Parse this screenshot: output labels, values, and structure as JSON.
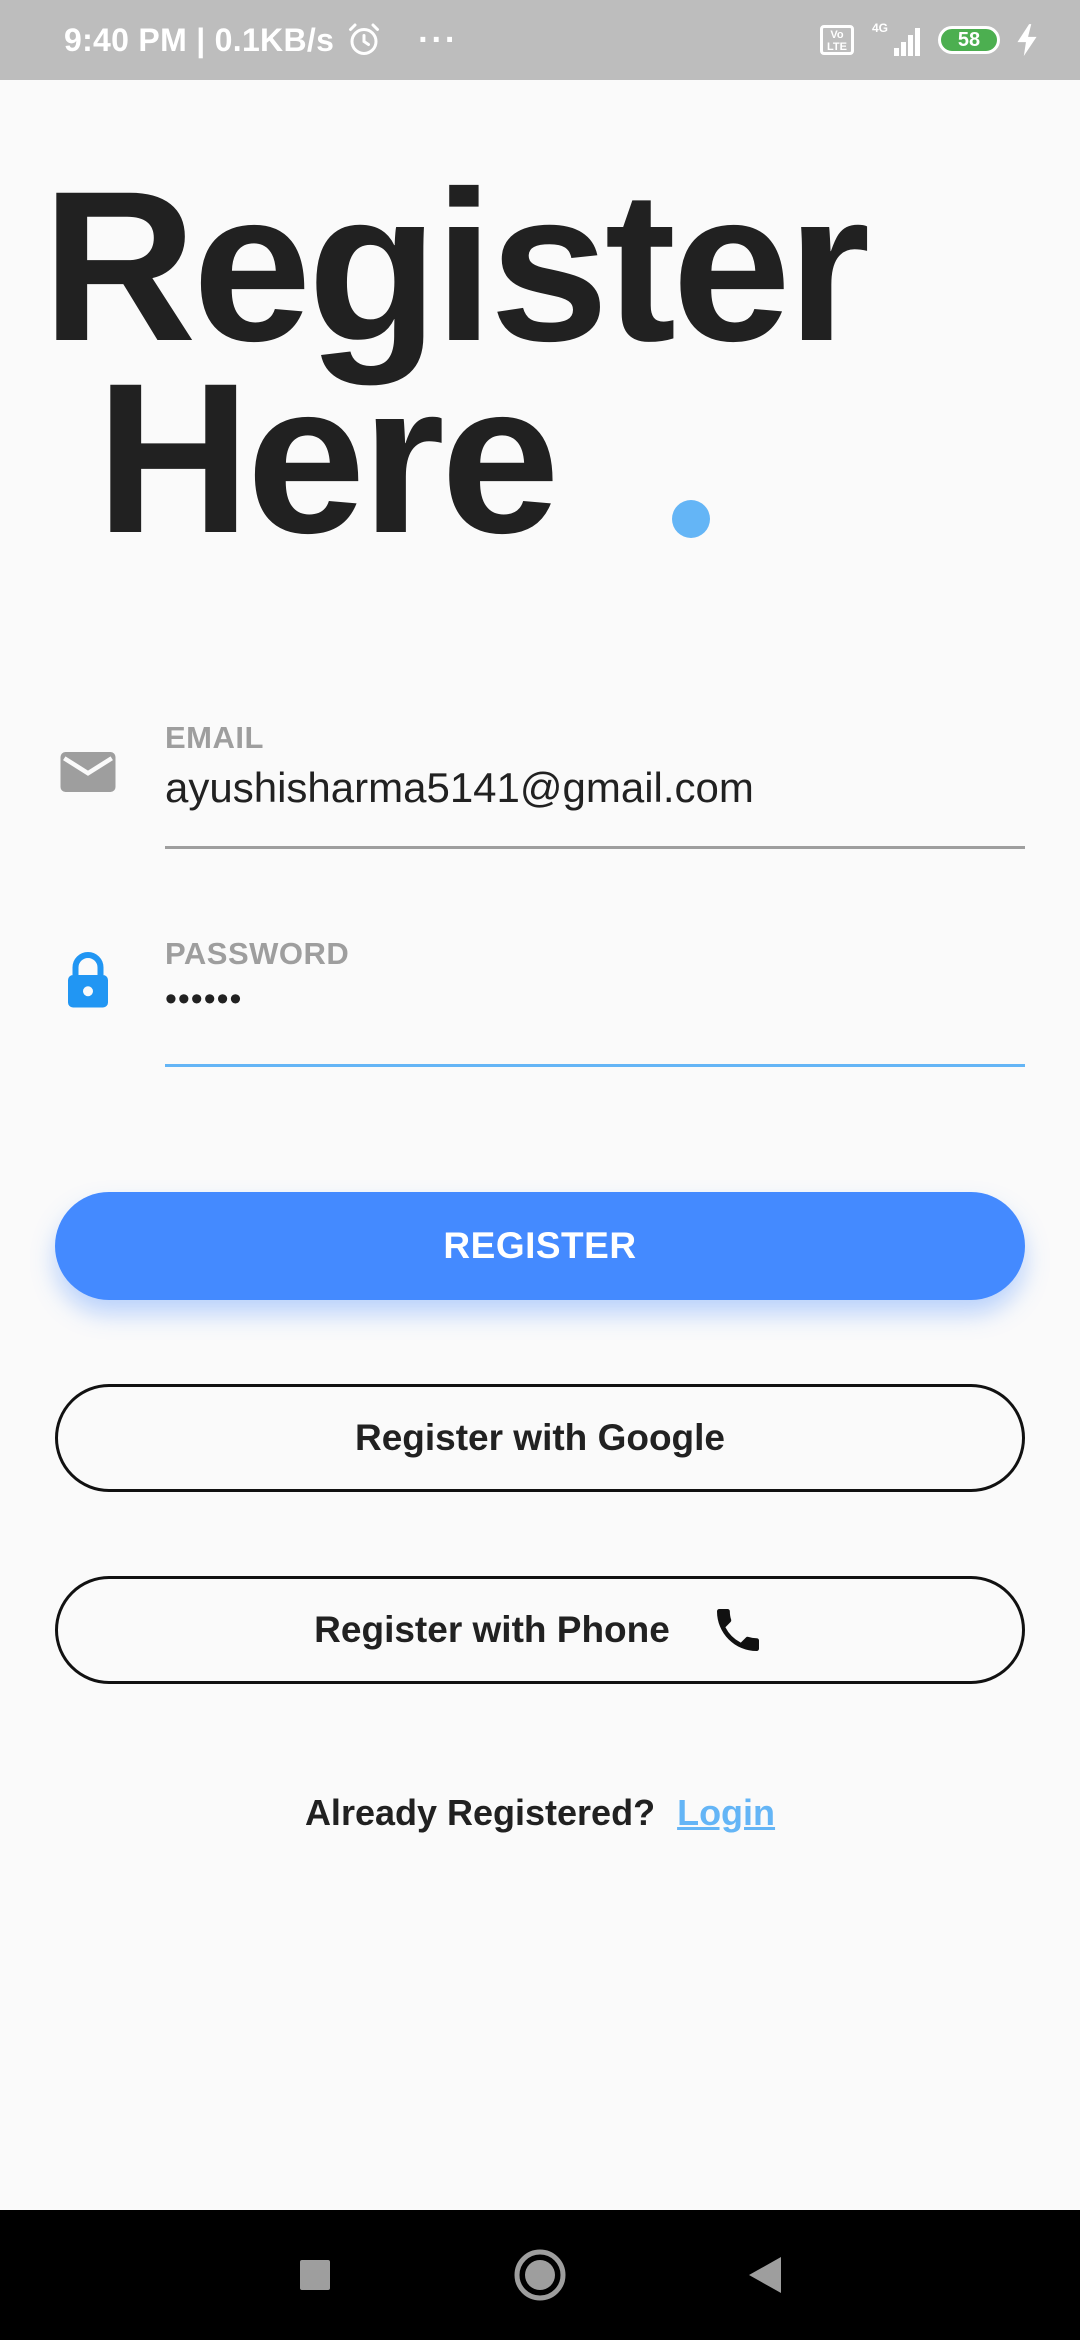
{
  "status_bar": {
    "time_speed": "9:40 PM | 0.1KB/s",
    "more": "···",
    "volte": "Vo LTE",
    "network": "4G",
    "battery": "58"
  },
  "header": {
    "title_line1": "Register",
    "title_line2": "Here"
  },
  "form": {
    "email": {
      "label": "EMAIL",
      "value": "ayushisharma5141@gmail.com",
      "icon": "mail-icon"
    },
    "password": {
      "label": "PASSWORD",
      "value": "••••••",
      "icon": "lock-icon"
    }
  },
  "buttons": {
    "register": "REGISTER",
    "google": "Register with Google",
    "phone": "Register with Phone"
  },
  "footer": {
    "prompt": "Already Registered?",
    "login": "Login"
  },
  "colors": {
    "primary": "#448aff",
    "accent": "#64b5f6",
    "status_bar": "#bdbdbd",
    "text": "#212121",
    "muted": "#9e9e9e"
  }
}
